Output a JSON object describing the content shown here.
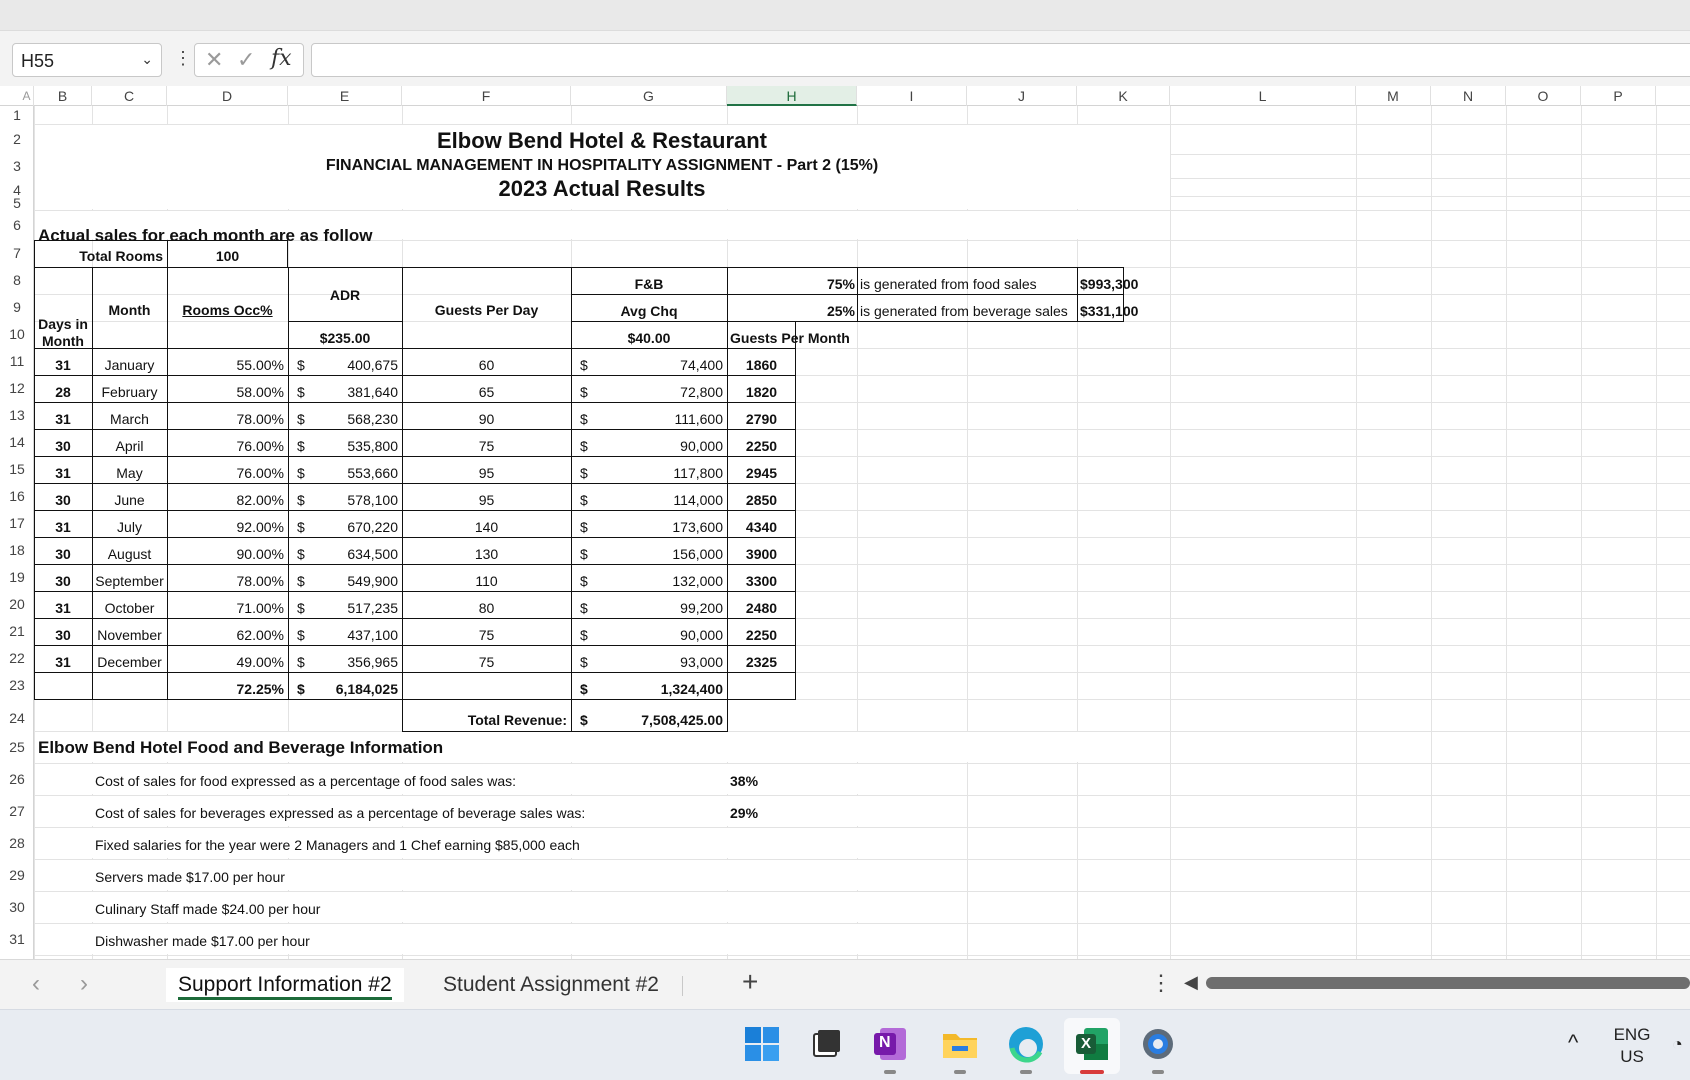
{
  "formula_bar": {
    "name_box": "H55",
    "name_box_arrow": "⌄",
    "dots": "⋮",
    "cancel_icon": "✕",
    "enter_icon": "✓",
    "fx_label": "fx",
    "formula": ""
  },
  "columns": [
    "A",
    "B",
    "C",
    "D",
    "E",
    "F",
    "G",
    "H",
    "I",
    "J",
    "K",
    "L",
    "M",
    "N",
    "O",
    "P"
  ],
  "rows": [
    "1",
    "2",
    "3",
    "4",
    "5",
    "6",
    "7",
    "8",
    "9",
    "10",
    "11",
    "12",
    "13",
    "14",
    "15",
    "16",
    "17",
    "18",
    "19",
    "20",
    "21",
    "22",
    "23",
    "24",
    "25",
    "26",
    "27",
    "28",
    "29",
    "30",
    "31"
  ],
  "sheet": {
    "title": "Elbow Bend Hotel  & Restaurant",
    "subtitle": "FINANCIAL  MANAGEMENT IN HOSPITALITY ASSIGNMENT - Part 2 (15%)",
    "year_title": "2023 Actual Results",
    "section1": "Actual  sales for each month are as follow",
    "total_rooms_label": "Total Rooms",
    "total_rooms_value": "100",
    "hdr_days": "Days in",
    "hdr_days2": "Month",
    "hdr_month": "Month",
    "hdr_occ": "Rooms Occ%",
    "hdr_adr": "ADR",
    "hdr_adr_value": "$235.00",
    "hdr_guests": "Guests Per Day",
    "hdr_fb": "F&B",
    "hdr_avgchq": "Avg Chq",
    "hdr_avgchq_value": "$40.00",
    "hdr_gpm": "Guests Per Month",
    "food_pct": "75%",
    "food_text": "is generated from food sales",
    "food_value": "$993,300",
    "bev_pct": "25%",
    "bev_text": "is generated from beverage sales",
    "bev_value": "$331,100",
    "currency": "$",
    "data_rows": [
      {
        "days": "31",
        "month": "January",
        "occ": "55.00%",
        "rev": "400,675",
        "guests": "60",
        "fb": "74,400",
        "gpm": "1860"
      },
      {
        "days": "28",
        "month": "February",
        "occ": "58.00%",
        "rev": "381,640",
        "guests": "65",
        "fb": "72,800",
        "gpm": "1820"
      },
      {
        "days": "31",
        "month": "March",
        "occ": "78.00%",
        "rev": "568,230",
        "guests": "90",
        "fb": "111,600",
        "gpm": "2790"
      },
      {
        "days": "30",
        "month": "April",
        "occ": "76.00%",
        "rev": "535,800",
        "guests": "75",
        "fb": "90,000",
        "gpm": "2250"
      },
      {
        "days": "31",
        "month": "May",
        "occ": "76.00%",
        "rev": "553,660",
        "guests": "95",
        "fb": "117,800",
        "gpm": "2945"
      },
      {
        "days": "30",
        "month": "June",
        "occ": "82.00%",
        "rev": "578,100",
        "guests": "95",
        "fb": "114,000",
        "gpm": "2850"
      },
      {
        "days": "31",
        "month": "July",
        "occ": "92.00%",
        "rev": "670,220",
        "guests": "140",
        "fb": "173,600",
        "gpm": "4340"
      },
      {
        "days": "30",
        "month": "August",
        "occ": "90.00%",
        "rev": "634,500",
        "guests": "130",
        "fb": "156,000",
        "gpm": "3900"
      },
      {
        "days": "30",
        "month": "September",
        "occ": "78.00%",
        "rev": "549,900",
        "guests": "110",
        "fb": "132,000",
        "gpm": "3300"
      },
      {
        "days": "31",
        "month": "October",
        "occ": "71.00%",
        "rev": "517,235",
        "guests": "80",
        "fb": "99,200",
        "gpm": "2480"
      },
      {
        "days": "30",
        "month": "November",
        "occ": "62.00%",
        "rev": "437,100",
        "guests": "75",
        "fb": "90,000",
        "gpm": "2250"
      },
      {
        "days": "31",
        "month": "December",
        "occ": "49.00%",
        "rev": "356,965",
        "guests": "75",
        "fb": "93,000",
        "gpm": "2325"
      }
    ],
    "total_occ": "72.25%",
    "total_rev": "6,184,025",
    "total_fb": "1,324,400",
    "total_revenue_label": "Total Revenue:",
    "total_revenue_value": "7,508,425.00",
    "section2": "Elbow Bend Hotel Food and Beverage Information",
    "info_food_cost": "Cost of sales for food expressed as a percentage of food sales was:",
    "info_food_cost_value": "38%",
    "info_bev_cost": "Cost of sales for beverages expressed as a percentage of beverage sales was:",
    "info_bev_cost_value": "29%",
    "info_salaries": "Fixed salaries for the year were 2 Managers and 1 Chef earning $85,000 each",
    "info_servers": "Servers made $17.00 per hour",
    "info_culinary": "Culinary Staff made $24.00 per hour",
    "info_dishwasher": "Dishwasher made $17.00 per hour"
  },
  "sheet_tabs": {
    "prev": "‹",
    "next": "›",
    "tab1": "Support Information #2",
    "tab2": "Student Assignment #2",
    "add": "+",
    "more": "⋮",
    "scroll_left": "◀"
  },
  "taskbar": {
    "onenote_letter": "N",
    "excel_letter": "X",
    "chevron": "^",
    "lang1": "ENG",
    "lang2": "US",
    "wifi": "◔"
  },
  "colors": {
    "excel_green": "#217346",
    "selected_col_bg": "#e3efe6"
  }
}
